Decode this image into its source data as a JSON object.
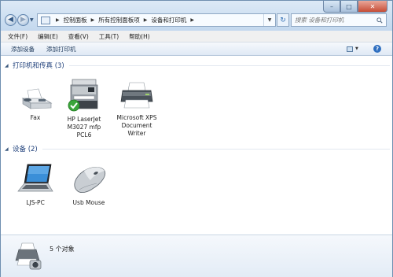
{
  "address_bar": {
    "breadcrumbs": [
      "控制面板",
      "所有控制面板项",
      "设备和打印机"
    ]
  },
  "search": {
    "placeholder": "搜索 设备和打印机"
  },
  "menu": {
    "items": [
      "文件(F)",
      "编辑(E)",
      "查看(V)",
      "工具(T)",
      "帮助(H)"
    ]
  },
  "commands": {
    "add_device": "添加设备",
    "add_printer": "添加打印机"
  },
  "groups": {
    "printers": {
      "title": "打印机和传真 (3)",
      "devices": [
        {
          "label": "Fax",
          "icon": "fax-icon"
        },
        {
          "label": "HP LaserJet M3027 mfp PCL6",
          "icon": "mfp-printer-icon",
          "default": true
        },
        {
          "label": "Microsoft XPS Document Writer",
          "icon": "printer-icon"
        }
      ]
    },
    "devices": {
      "title": "设备 (2)",
      "devices": [
        {
          "label": "LJS-PC",
          "icon": "laptop-icon"
        },
        {
          "label": "Usb Mouse",
          "icon": "mouse-icon"
        }
      ]
    }
  },
  "details": {
    "count_text": "5 个对象"
  },
  "colors": {
    "accent": "#1e3f7a",
    "default_check": "#3ba53b"
  }
}
